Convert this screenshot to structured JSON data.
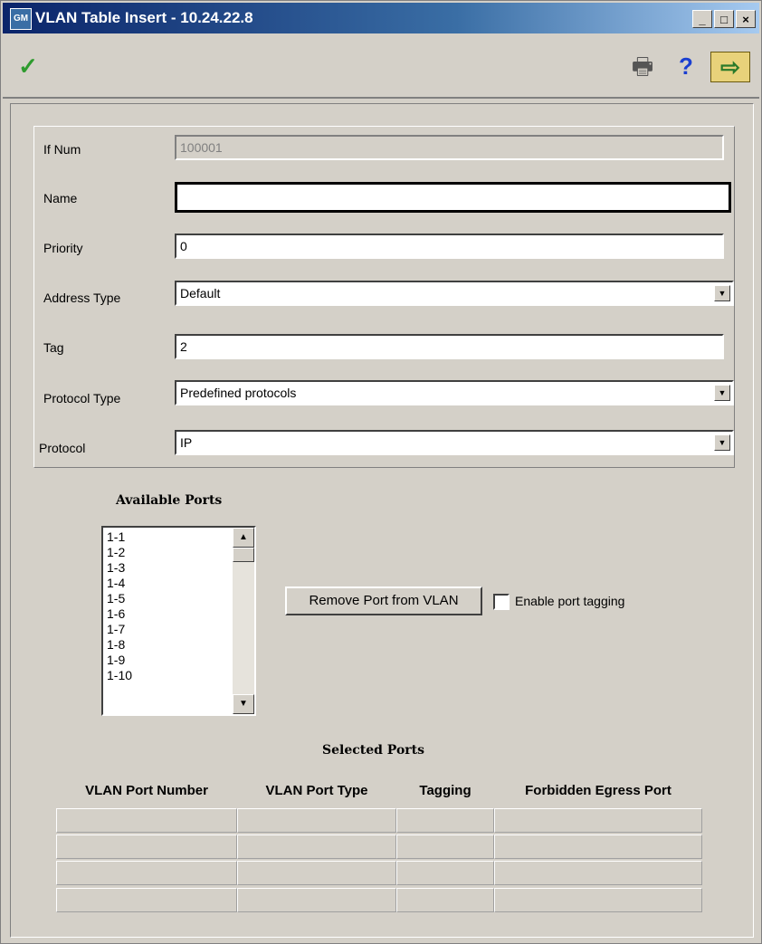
{
  "window": {
    "title": "VLAN Table Insert - 10.24.22.8",
    "app_icon_text": "GM",
    "minimize_glyph": "_",
    "maximize_glyph": "□",
    "close_glyph": "×"
  },
  "toolbar": {
    "apply_glyph": "✓",
    "print_glyph": "🖶",
    "help_glyph": "?",
    "exit_glyph": "⇨"
  },
  "form": {
    "ifnum_label": "If Num",
    "ifnum_value": "100001",
    "name_label": "Name",
    "name_value": "",
    "priority_label": "Priority",
    "priority_value": "0",
    "address_type_label": "Address Type",
    "address_type_value": "Default",
    "tag_label": "Tag",
    "tag_value": "2",
    "protocol_type_label": "Protocol Type",
    "protocol_type_value": "Predefined protocols",
    "protocol_label": "Protocol",
    "protocol_value": "IP"
  },
  "ports": {
    "available_heading": "Available Ports",
    "items": [
      "1-1",
      "1-2",
      "1-3",
      "1-4",
      "1-5",
      "1-6",
      "1-7",
      "1-8",
      "1-9",
      "1-10"
    ],
    "remove_button": "Remove Port from VLAN",
    "enable_tagging_label": "Enable port tagging",
    "selected_heading": "Selected Ports",
    "columns": [
      "VLAN Port Number",
      "VLAN Port Type",
      "Tagging",
      "Forbidden Egress Port"
    ]
  },
  "colors": {
    "face": "#d4d0c8",
    "title_start": "#0a246a",
    "check_green": "#2e9b2e",
    "help_blue": "#1a3fd1"
  }
}
